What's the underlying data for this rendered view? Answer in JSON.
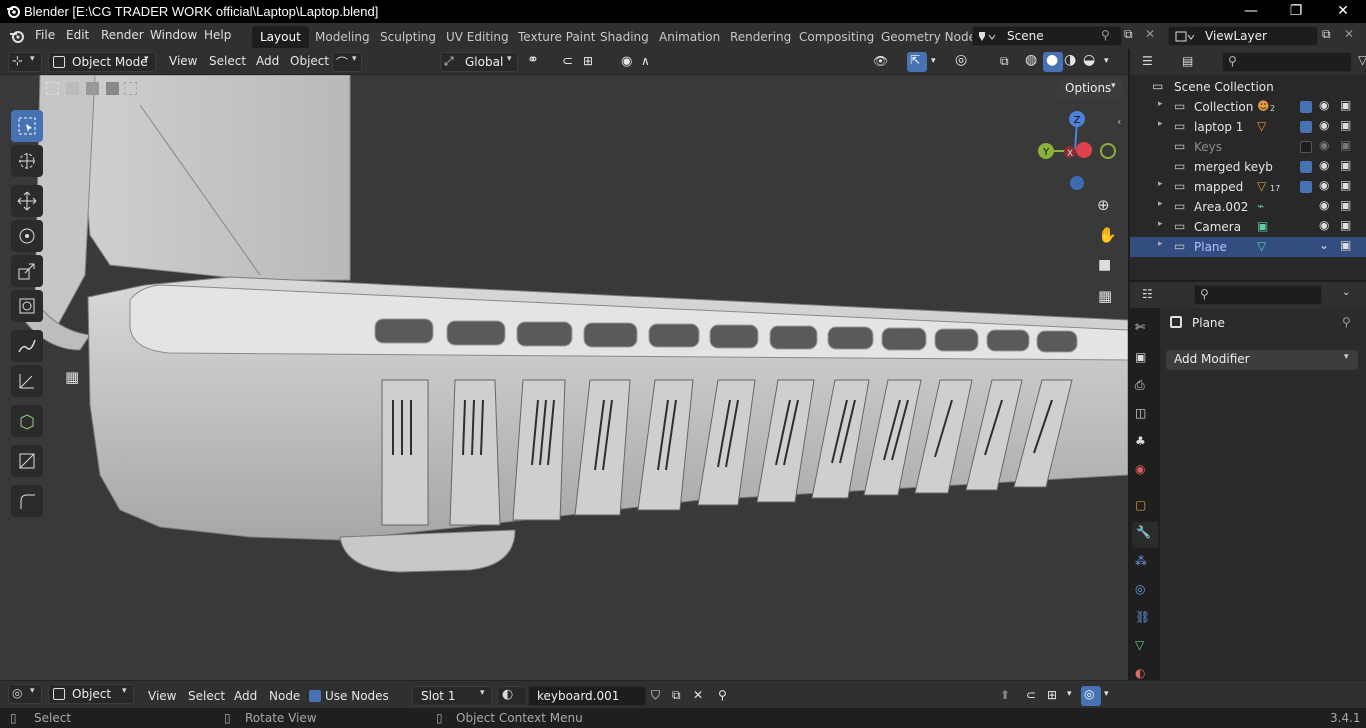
{
  "window": {
    "title": "Blender [E:\\CG TRADER WORK official\\Laptop\\Laptop.blend]",
    "minimize": "—",
    "maximize": "❐",
    "close": "✕"
  },
  "menu": {
    "file": "File",
    "edit": "Edit",
    "render": "Render",
    "window": "Window",
    "help": "Help"
  },
  "workspaces": [
    "Layout",
    "Modeling",
    "Sculpting",
    "UV Editing",
    "Texture Paint",
    "Shading",
    "Animation",
    "Rendering",
    "Compositing",
    "Geometry Node"
  ],
  "scene": {
    "name": "Scene",
    "view_layer": "ViewLayer"
  },
  "viewport_header": {
    "mode": "Object Mode",
    "view": "View",
    "select": "Select",
    "add": "Add",
    "object": "Object",
    "transform_orientation": "Global",
    "options": "Options"
  },
  "gizmo": {
    "z": "Z",
    "y": "Y",
    "x": "X"
  },
  "outliner": {
    "root": "Scene Collection",
    "items": [
      {
        "label": "Collection",
        "badge": "2",
        "checked": true,
        "dim": false,
        "selected": false
      },
      {
        "label": "laptop 1",
        "badge": "",
        "checked": true,
        "dim": false,
        "selected": false
      },
      {
        "label": "Keys",
        "badge": "",
        "checked": false,
        "dim": true,
        "selected": false
      },
      {
        "label": "merged keyb",
        "badge": "",
        "checked": true,
        "dim": false,
        "selected": false
      },
      {
        "label": "mapped",
        "badge": "17",
        "checked": true,
        "dim": false,
        "selected": false
      },
      {
        "label": "Area.002",
        "badge": "",
        "checked": null,
        "dim": false,
        "selected": false
      },
      {
        "label": "Camera",
        "badge": "",
        "checked": null,
        "dim": false,
        "selected": false
      },
      {
        "label": "Plane",
        "badge": "",
        "checked": null,
        "dim": false,
        "selected": true
      }
    ]
  },
  "properties": {
    "object_name": "Plane",
    "add_modifier": "Add Modifier"
  },
  "shader_header": {
    "editor": "Object",
    "view": "View",
    "select": "Select",
    "add": "Add",
    "node": "Node",
    "use_nodes": "Use Nodes",
    "slot": "Slot 1",
    "material": "keyboard.001"
  },
  "statusbar": {
    "select": "Select",
    "rotate": "Rotate View",
    "context": "Object Context Menu",
    "version": "3.4.1"
  },
  "colors": {
    "accent": "#4772b3",
    "selected_row": "#334d80",
    "gizmo_x": "#e0424c",
    "gizmo_y": "#8ab13a",
    "gizmo_z": "#4e82d8"
  }
}
